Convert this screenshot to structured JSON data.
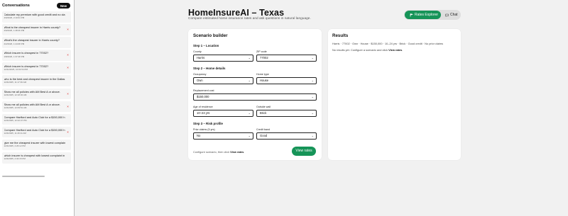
{
  "sidebar": {
    "title": "Conversations",
    "new_label": "New",
    "items": [
      {
        "title": "Calculate my premium with good credit and no cla",
        "time": "4/9/2026, 2:10:04 PM",
        "deletable": false
      },
      {
        "title": "What is the cheapest insurer in Harris county?",
        "time": "4/9/2026, 1:48:46 PM",
        "deletable": true
      },
      {
        "title": "What's the cheapest insurer in Harris county?",
        "time": "2/2/2026, 1:44:08 PM",
        "deletable": false
      },
      {
        "title": "Which insurer is cheapest in 77002?",
        "time": "1/8/2026, 1:37:48 PM",
        "deletable": true
      },
      {
        "title": "Which insurer is cheapest in 77002?",
        "time": "12/11/2025, 10:01:54 PM",
        "deletable": true
      },
      {
        "title": "who is the best and cheapest insurer in the Dallas",
        "time": "12/4/2025, 11:17:36 AM",
        "deletable": false
      },
      {
        "title": "Show me all policies with AM Best A or above.",
        "time": "12/4/2025, 12:18:32 AM",
        "deletable": true
      },
      {
        "title": "Show me all policies with AM Best A or above.",
        "time": "12/4/2025, 12:09:51 AM",
        "deletable": true
      },
      {
        "title": "Compare Hartford and Auto Club for a $150,000 h",
        "time": "12/4/2025, 12:22:47 PM",
        "deletable": false
      },
      {
        "title": "Compare Hartford and Auto Club for a $150,000 h",
        "time": "12/4/2025, 11:46:11 AM",
        "deletable": true
      },
      {
        "title": "give me the cheapest insurer with lowest complaint",
        "time": "12/4/2025, 2:26:12 PM",
        "deletable": false
      },
      {
        "title": "which insurer is cheapest with lowest complaint in",
        "time": "12/4/2025, 2:32:15 PM",
        "deletable": false
      }
    ]
  },
  "header": {
    "title": "HomeInsureAI – Texas",
    "subtitle": "Compare estimated home insurance rates and ask questions in natural language."
  },
  "tabs": {
    "explorer_label": "Rates Explorer",
    "chat_label": "Chat"
  },
  "builder": {
    "title": "Scenario builder",
    "step1": "Step 1 – Location",
    "step2": "Step 2 – Home details",
    "step3": "Step 3 – Risk profile",
    "county_label": "County",
    "county_value": "Harris",
    "zip_label": "ZIP code",
    "zip_value": "77002",
    "occupancy_label": "Occupancy",
    "occupancy_value": "Own",
    "hometype_label": "Home type",
    "hometype_value": "House",
    "replacement_label": "Replacement cost",
    "replacement_value": "$150,000",
    "age_label": "Age of residence",
    "age_value": "10–24 yrs",
    "wall_label": "Outside wall",
    "wall_value": "Brick",
    "claims_label": "Prior claims (5 yrs)",
    "claims_value": "No",
    "credit_label": "Credit band",
    "credit_value": "Good",
    "footer_prefix": "Configure scenario, then click",
    "footer_link": "View rates",
    "footer_suffix": ".",
    "view_button": "View rates"
  },
  "results": {
    "title": "Results",
    "summary": "Harris · 77002 · Own · House · $150,000 · 10–24 yrs · Brick · Good credit · No prior claims",
    "empty_prefix": "No results yet. Configure a scenario and click",
    "empty_link": "View rates",
    "empty_suffix": "."
  },
  "colors": {
    "accent": "#169458",
    "delete": "#dd2222"
  }
}
